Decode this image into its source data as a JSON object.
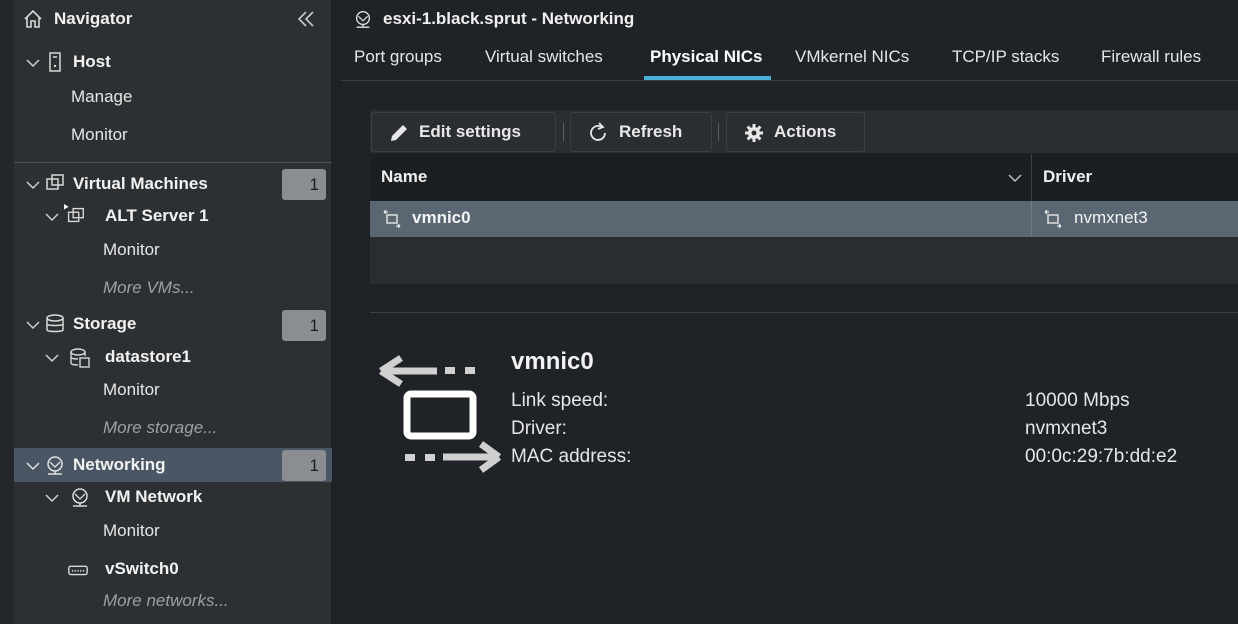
{
  "navigator": {
    "title": "Navigator",
    "host": {
      "label": "Host",
      "manage": "Manage",
      "monitor": "Monitor"
    },
    "virtual_machines": {
      "label": "Virtual Machines",
      "count": "1",
      "vm": {
        "label": "ALT Server 1",
        "monitor": "Monitor"
      },
      "more": "More VMs..."
    },
    "storage": {
      "label": "Storage",
      "count": "1",
      "datastore": {
        "label": "datastore1",
        "monitor": "Monitor"
      },
      "more": "More storage..."
    },
    "networking": {
      "label": "Networking",
      "count": "1",
      "vm_network": {
        "label": "VM Network",
        "monitor": "Monitor"
      },
      "vswitch": {
        "label": "vSwitch0"
      },
      "more": "More networks..."
    }
  },
  "main": {
    "title": "esxi-1.black.sprut - Networking",
    "tabs": [
      {
        "label": "Port groups"
      },
      {
        "label": "Virtual switches"
      },
      {
        "label": "Physical NICs",
        "active": true
      },
      {
        "label": "VMkernel NICs"
      },
      {
        "label": "TCP/IP stacks"
      },
      {
        "label": "Firewall rules"
      }
    ],
    "toolbar": {
      "edit_settings": "Edit settings",
      "refresh": "Refresh",
      "actions": "Actions"
    },
    "grid": {
      "columns": [
        "Name",
        "Driver"
      ],
      "rows": [
        {
          "name": "vmnic0",
          "driver": "nvmxnet3"
        }
      ]
    },
    "detail": {
      "name": "vmnic0",
      "fields": [
        {
          "label": "Link speed:",
          "value": "10000 Mbps"
        },
        {
          "label": "Driver:",
          "value": "nvmxnet3"
        },
        {
          "label": "MAC address:",
          "value": "00:0c:29:7b:dd:e2"
        }
      ]
    }
  },
  "colors": {
    "accent": "#49afd9",
    "selected_row": "#5a6772",
    "selected_nav": "#4a5663",
    "badge": "#8a8e92"
  },
  "icons": [
    "home-icon",
    "double-chevron-left-icon",
    "chevron-down-icon",
    "server-icon",
    "vm-icon",
    "database-icon",
    "datastore-icon",
    "network-icon",
    "switch-icon",
    "pencil-icon",
    "refresh-icon",
    "gear-icon",
    "nic-icon"
  ]
}
